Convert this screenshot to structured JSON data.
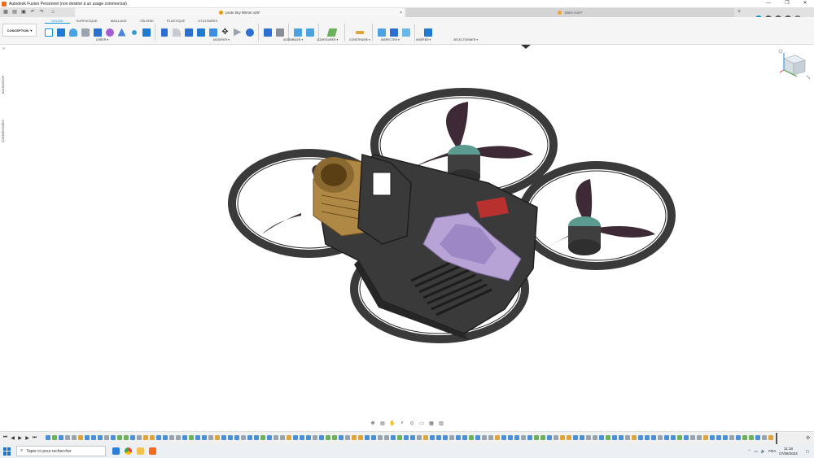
{
  "window": {
    "title": "Autodesk Fusion Personnel (non destiné à un usage commercial)",
    "controls": [
      "—",
      "❐",
      "✕"
    ]
  },
  "tabs": {
    "active": {
      "label": "proto tiny 90mm v25*",
      "close": "×"
    },
    "other": {
      "label": "Sans nom*"
    },
    "new_tab": "+"
  },
  "ribbon": {
    "workspace": "CONCEPTION",
    "workspace_arrow": "▾",
    "tabs": [
      "SOLIDE",
      "SURFACIQUE",
      "MAILLAGE",
      "TÔLERIE",
      "PLASTIQUE",
      "UTILITAIRES"
    ],
    "active_tab": "SOLIDE",
    "groups": [
      "CRÉER ▾",
      "MODIFIER ▾",
      "ASSEMBLER ▾",
      "CONFIGURER ▾",
      "CONSTRUIRE ▾",
      "INSPECTER ▾",
      "INSÉRER ▾",
      "SÉLECTIONNER ▾"
    ]
  },
  "left_panel": {
    "navigator": "NAVIGATEUR",
    "comments": "COMMENTAIRES"
  },
  "taskbar": {
    "search_placeholder": "Taper ici pour rechercher",
    "lang": "FRA",
    "time": "11:18",
    "date": "07/08/2024"
  },
  "colors": {
    "accent": "#0696d7",
    "frame": "#3a3a3a",
    "motor": "#5b9a8f",
    "prop": "#3d2a36",
    "battery": "#b8a3d6",
    "camera": "#b08845"
  }
}
